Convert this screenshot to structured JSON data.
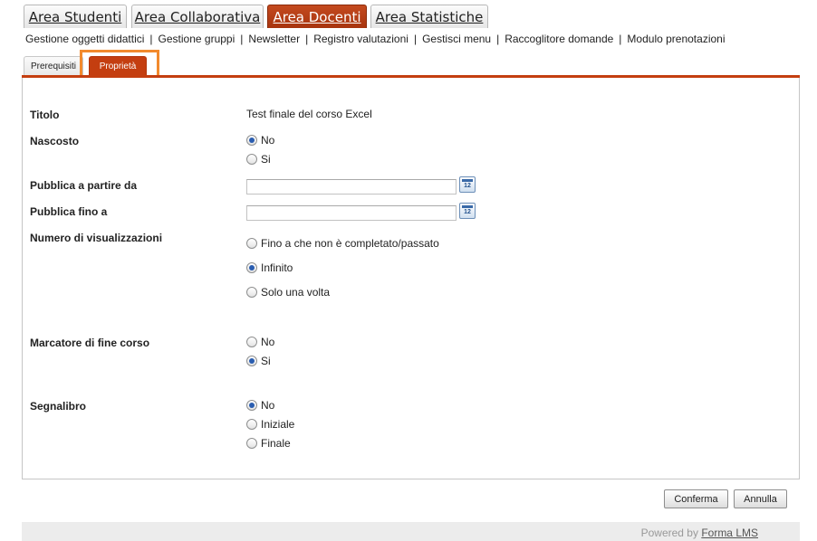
{
  "areas": [
    {
      "label": "Area Studenti"
    },
    {
      "label": "Area Collaborativa"
    },
    {
      "label": "Area Docenti"
    },
    {
      "label": "Area Statistiche"
    }
  ],
  "subnav": [
    "Gestione oggetti didattici",
    "Gestione gruppi",
    "Newsletter",
    "Registro valutazioni",
    "Gestisci menu",
    "Raccoglitore domande",
    "Modulo prenotazioni"
  ],
  "subnav_separator": "|",
  "tabs": {
    "prerequisiti": "Prerequisiti",
    "proprieta": "Proprietà"
  },
  "form": {
    "titolo": {
      "label": "Titolo",
      "value": "Test finale del corso Excel"
    },
    "nascosto": {
      "label": "Nascosto",
      "options": [
        "No",
        "Si"
      ],
      "selected": "No"
    },
    "pubblica_da": {
      "label": "Pubblica a partire da",
      "value": ""
    },
    "pubblica_fino": {
      "label": "Pubblica fino a",
      "value": ""
    },
    "calendar_day": "12",
    "visualizzazioni": {
      "label": "Numero di visualizzazioni",
      "options": [
        "Fino a che non è completato/passato",
        "Infinito",
        "Solo una volta"
      ],
      "selected": "Infinito"
    },
    "marcatore": {
      "label": "Marcatore di fine corso",
      "options": [
        "No",
        "Si"
      ],
      "selected": "Si"
    },
    "segnalibro": {
      "label": "Segnalibro",
      "options": [
        "No",
        "Iniziale",
        "Finale"
      ],
      "selected": "No"
    }
  },
  "buttons": {
    "confirm": "Conferma",
    "cancel": "Annulla"
  },
  "footer": {
    "prefix": "Powered by",
    "link": "Forma LMS"
  },
  "colors": {
    "accent": "#c43e10",
    "highlight": "#f28a2d",
    "radio_dot": "#2a5db0"
  }
}
